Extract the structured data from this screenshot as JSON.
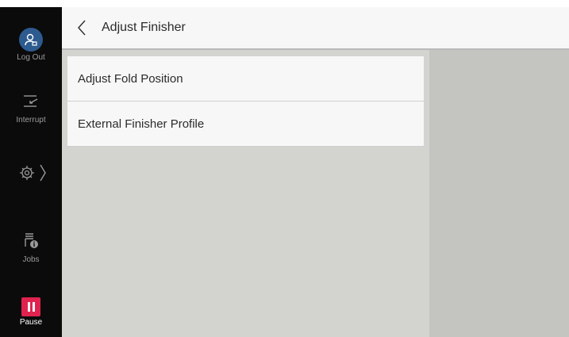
{
  "header": {
    "title": "Adjust Finisher"
  },
  "sidebar": {
    "logout_label": "Log Out",
    "interrupt_label": "Interrupt",
    "jobs_label": "Jobs",
    "pause_label": "Pause"
  },
  "menu": {
    "items": [
      {
        "label": "Adjust Fold Position"
      },
      {
        "label": "External Finisher Profile"
      }
    ]
  },
  "colors": {
    "sidebar_bg": "#0b0b0b",
    "avatar": "#2d5b8f",
    "pause": "#e0234e",
    "content_bg": "#d3d3d0",
    "right_pane_bg": "#c4c4c1"
  },
  "icons": [
    "user-icon",
    "interrupt-icon",
    "gear-icon",
    "chevron-right-icon",
    "jobs-icon",
    "pause-icon",
    "back-arrow-icon"
  ]
}
